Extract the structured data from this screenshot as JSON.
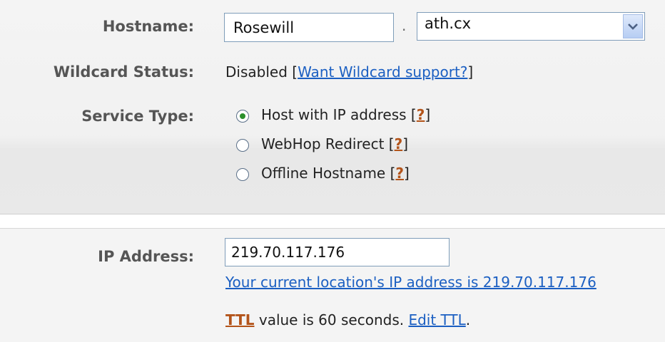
{
  "hostname": {
    "label": "Hostname:",
    "name_value": "Rosewill",
    "separator": ".",
    "domain_value": "ath.cx"
  },
  "wildcard": {
    "label": "Wildcard Status:",
    "status": "Disabled",
    "open_bracket": "[",
    "link_text": "Want Wildcard support?",
    "close_bracket": "]"
  },
  "service_type": {
    "label": "Service Type:",
    "help_text": "?",
    "options": [
      {
        "label": "Host with IP address",
        "checked": true
      },
      {
        "label": "WebHop Redirect",
        "checked": false
      },
      {
        "label": "Offline Hostname",
        "checked": false
      }
    ]
  },
  "ip": {
    "label": "IP Address:",
    "value": "219.70.117.176",
    "current_link": "Your current location's IP address is 219.70.117.176"
  },
  "ttl": {
    "ttl_link": "TTL",
    "text": "value is 60 seconds.",
    "edit_link": "Edit TTL",
    "trailing": "."
  },
  "colors": {
    "link": "#1b5fc2",
    "help": "#b3541a",
    "radio_checked": "#2b8f2b"
  }
}
